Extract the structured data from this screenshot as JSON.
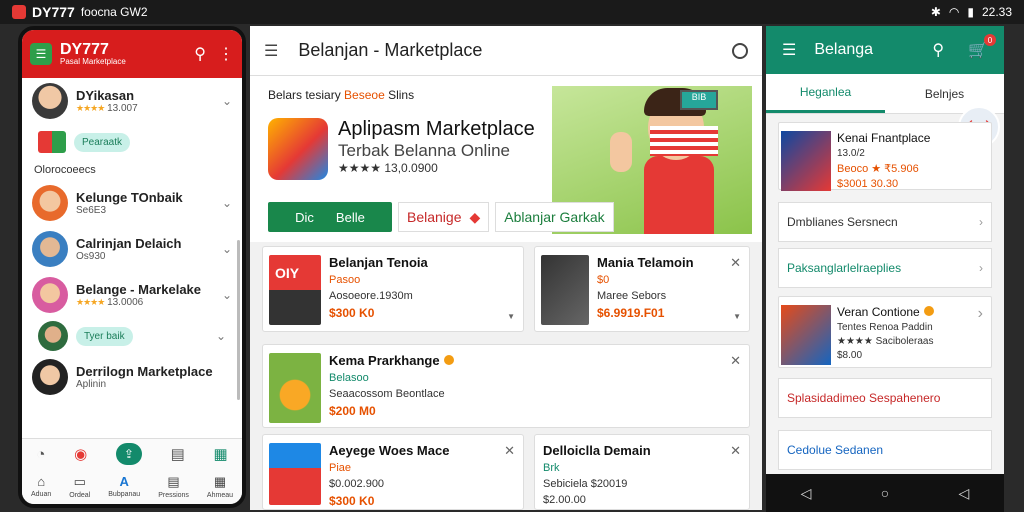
{
  "status": {
    "brand": "DY777",
    "left_text": "foocna  GW2",
    "time": "22.33"
  },
  "left_phone": {
    "brand": "DY777",
    "subbrand": "Pasal Marketplace",
    "chats": [
      {
        "name": "DYikasan",
        "rating": "★★★★",
        "sub": "13.007"
      },
      {
        "name": "Kelunge TOnbaik",
        "sub": "Se6E3"
      },
      {
        "name": "Calrinjan Delaich",
        "sub": "Os930"
      },
      {
        "name": "Belange - Markelake",
        "rating": "★★★★",
        "sub": "13.0006"
      },
      {
        "name": "Derrilogn Marketplace",
        "sub": "Aplinin"
      }
    ],
    "pill1": "Pearaatk",
    "pill2": "Tyer baik",
    "section": "Olorocoeecs",
    "nav": [
      {
        "icon": "⌂",
        "label": "Aduan"
      },
      {
        "icon": "▭",
        "label": "Ordeal"
      },
      {
        "icon": "A",
        "label": "Bubpanau"
      },
      {
        "icon": "▤",
        "label": "Pressions"
      },
      {
        "icon": "▦",
        "label": "Ahmeau"
      }
    ]
  },
  "center": {
    "search_title": "Belanjan - Marketplace",
    "hero_tag": "Belars tesiary",
    "hero_tag_hl": "Beseoe",
    "hero_tag_end": "Slins",
    "app_name": "Aplipasm Marketplace",
    "app_sub": "Terbak Belanna Online",
    "app_rating": "★★★★ 13,0.0900",
    "btn_green_a": "Dic",
    "btn_green_b": "Belle",
    "btn_outline_a": "Belanige",
    "btn_outline_b": "Ablanjar Garkak",
    "screen_label": "BIB",
    "cards": [
      {
        "name": "Belanjan Tenoia",
        "sub": "Pasoo",
        "sub2": "Aosoeore.1930m",
        "price": "$300 K0",
        "thumb_label": "OIY"
      },
      {
        "name": "Mania Telamoin",
        "sub": "$0",
        "sub2": "Maree Sebors",
        "price": "$6.9919.F01"
      },
      {
        "name": "Kema Prarkhange",
        "sub": "Belasoo",
        "sub2": "Seaacossom Beontlace",
        "price": "$200 M0"
      },
      {
        "name": "Aeyege Woes Mace",
        "sub": "Piae",
        "sub2": "$0.002.900",
        "price": "$300 K0"
      },
      {
        "name": "Delloiclla Demain",
        "sub": "Brk",
        "sub2": "Sebiciela $20019",
        "price": "$2.00.00"
      }
    ]
  },
  "right_phone": {
    "title": "Belanga",
    "cart_count": "0",
    "tab_a": "Heganlea",
    "tab_b": "Belnjes",
    "round": "↰↱",
    "card1": {
      "name": "Kenai Fnantplace",
      "sub": "13.0/2",
      "sub2": "Beoco ★ ₹5.906",
      "price": "$3001 30.30"
    },
    "row1": "Dmblianes Sersnecn",
    "row2": "Paksanglarlelraeplies",
    "card2": {
      "name": "Veran Contione",
      "sub": "Tentes Renoa Paddin",
      "sub2": "★★★★ Saciboleraas",
      "price": "$8.00"
    },
    "row3": "Splasidadimeo Sespahenero",
    "row4": "Cedolue Sedanen",
    "colors": {
      "accent": "#138a6b",
      "brand_red": "#d71d1d"
    }
  }
}
